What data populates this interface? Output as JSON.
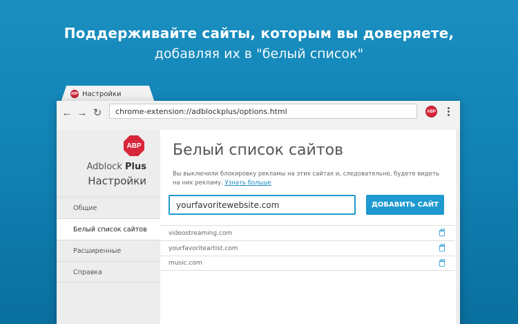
{
  "headline": {
    "line1": "Поддерживайте сайты, которым вы доверяете,",
    "line2": "добавляя их в \"белый список\""
  },
  "browser": {
    "tab_title": "Настройки",
    "tab_favicon": "ABP",
    "address_url": "chrome-extension://adblockplus/options.html",
    "extension_icon": "ABP"
  },
  "sidebar": {
    "logo_text": "ABP",
    "brand_name": "Adblock",
    "brand_name_bold": "Plus",
    "subtitle": "Настройки",
    "items": [
      {
        "label": "Общие"
      },
      {
        "label": "Белый список сайтов"
      },
      {
        "label": "Расширенные"
      },
      {
        "label": "Справка"
      }
    ]
  },
  "main": {
    "title": "Белый список сайтов",
    "description": "Вы выключили блокировку рекламы на этих сайтах и, следовательно, будете видеть на них рекламу.",
    "learn_more": "Узнать больше",
    "input_value": "yourfavoritewebsite.com",
    "add_button": "ДОБАВИТЬ САЙТ",
    "sites": [
      {
        "domain": "videostreaming.com"
      },
      {
        "domain": "yourfavoriteartist.com"
      },
      {
        "domain": "music.com"
      }
    ]
  },
  "colors": {
    "background": "#1283b6",
    "accent": "#1e9ad0",
    "abp_red": "#d7253a"
  },
  "icons": [
    "back-arrow-icon",
    "forward-arrow-icon",
    "reload-icon",
    "abp-extension-icon",
    "menu-dots-icon",
    "trash-icon"
  ]
}
